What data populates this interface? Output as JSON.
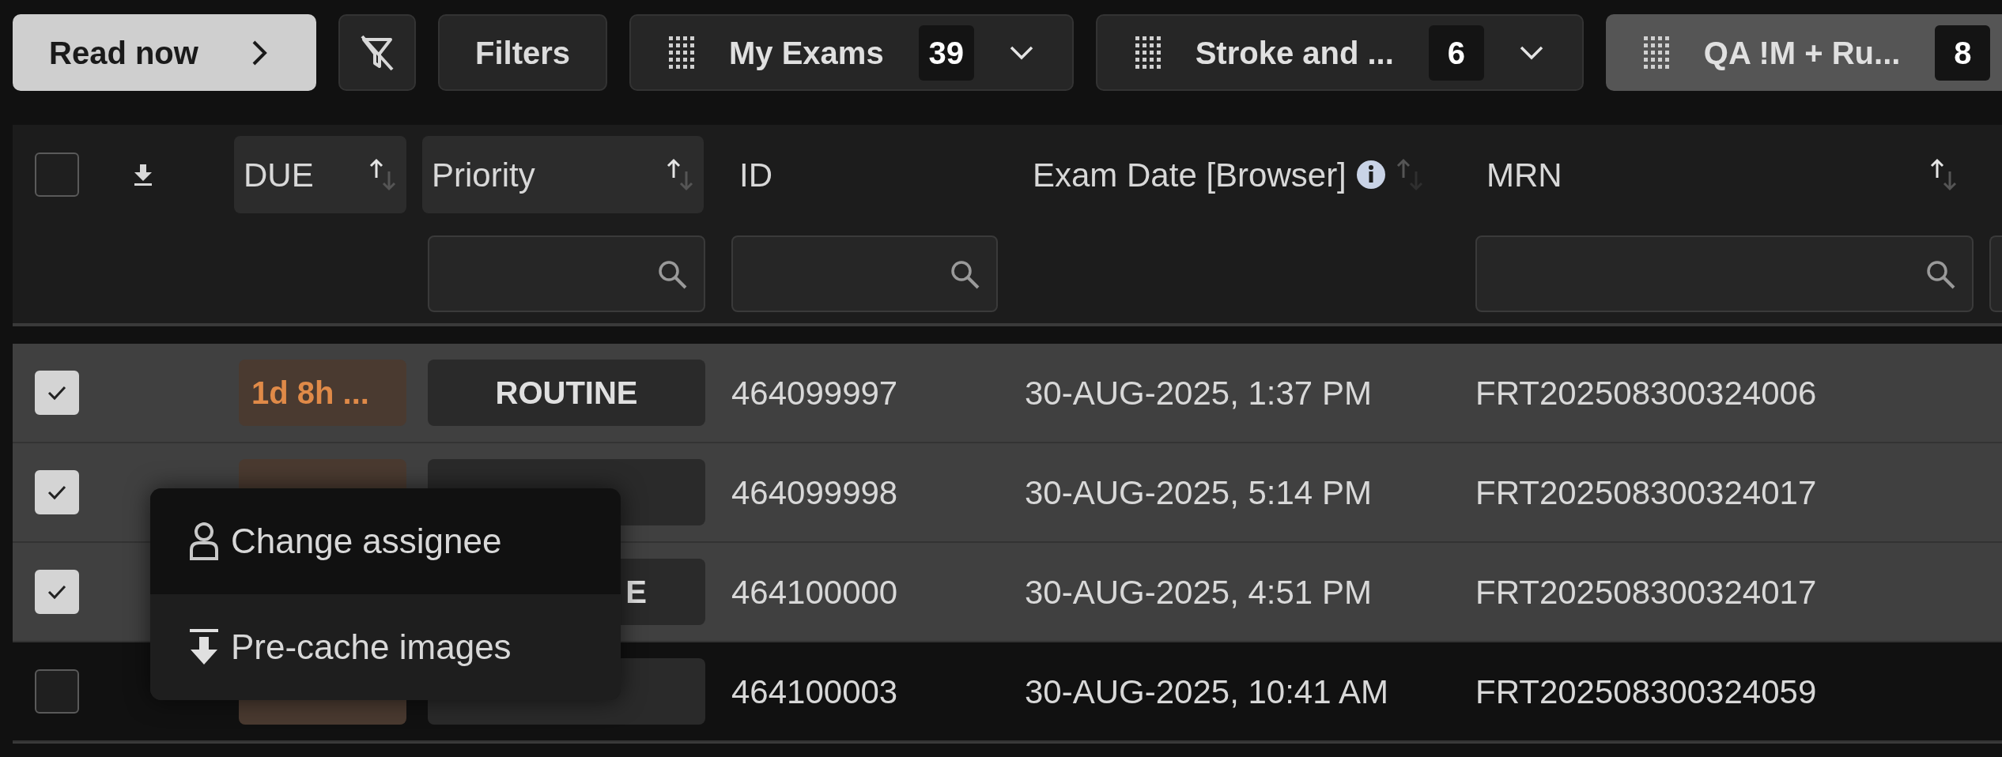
{
  "toolbar": {
    "read_now": "Read now",
    "filters": "Filters"
  },
  "worklist_tabs": [
    {
      "label": "My Exams",
      "count": "39",
      "selected": false
    },
    {
      "label": "Stroke and ...",
      "count": "6",
      "selected": false
    },
    {
      "label": "QA !M + Ru...",
      "count": "8",
      "selected": true
    }
  ],
  "table": {
    "select_all": {
      "checked": false
    },
    "columns": [
      {
        "label": "DUE",
        "kind": "pill",
        "filter": false
      },
      {
        "label": "Priority",
        "kind": "pill",
        "filter": true
      },
      {
        "label": "ID",
        "kind": "plain",
        "filter": true
      },
      {
        "label": "Exam Date [Browser]",
        "kind": "info",
        "filter": false
      },
      {
        "label": "MRN",
        "kind": "sort",
        "filter": true
      }
    ],
    "rows": [
      {
        "selected": true,
        "due": "1d 8h ...",
        "priority": "ROUTINE",
        "id": "464099997",
        "exam_date": "30-AUG-2025, 1:37 PM",
        "mrn": "FRT202508300324006"
      },
      {
        "selected": true,
        "id": "464099998",
        "exam_date": "30-AUG-2025, 5:14 PM",
        "mrn": "FRT202508300324017"
      },
      {
        "selected": true,
        "priority_tail": "E",
        "id": "464100000",
        "exam_date": "30-AUG-2025, 4:51 PM",
        "mrn": "FRT202508300324017"
      },
      {
        "selected": false,
        "id": "464100003",
        "exam_date": "30-AUG-2025, 10:41 AM",
        "mrn": "FRT202508300324059"
      }
    ]
  },
  "context_menu": {
    "items": [
      {
        "kind": "assignee",
        "label": "Change assignee",
        "highlighted": true
      },
      {
        "kind": "precache",
        "label": "Pre-cache images",
        "highlighted": false
      }
    ]
  }
}
